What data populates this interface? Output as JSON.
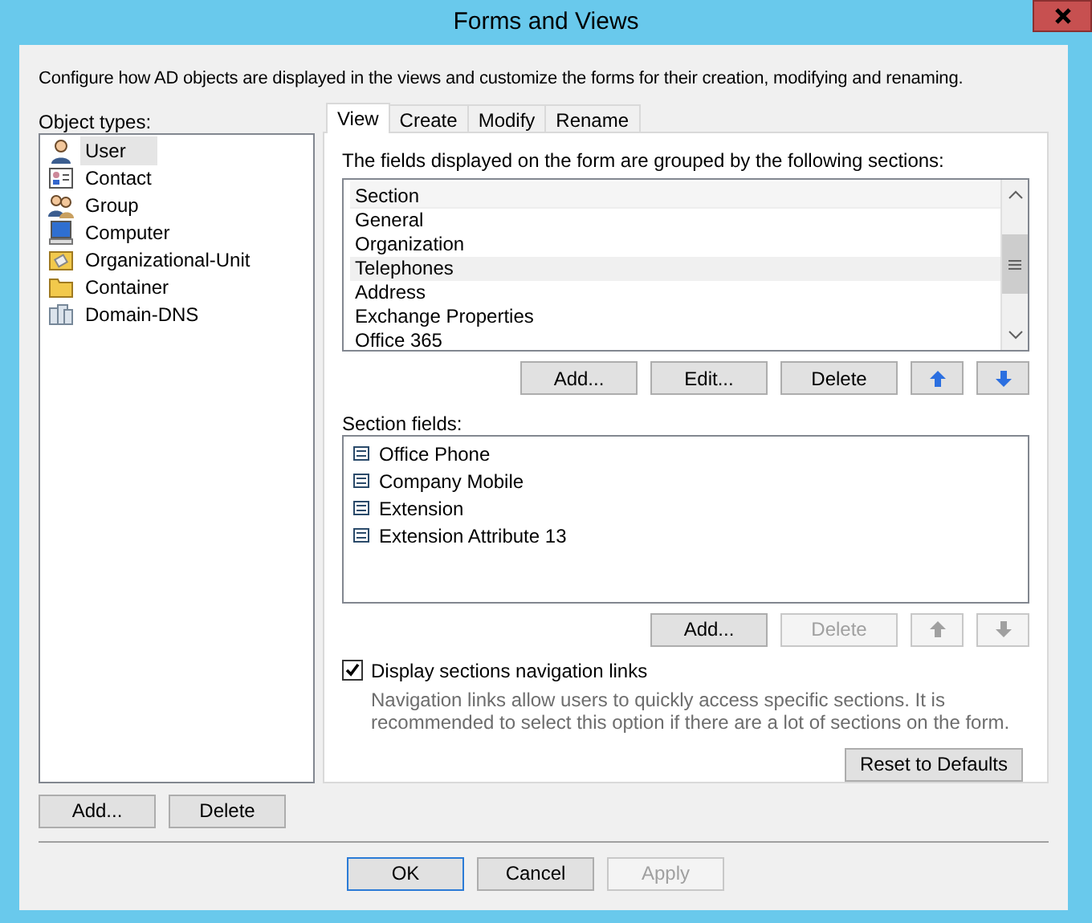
{
  "window": {
    "title": "Forms and Views"
  },
  "description": "Configure how AD objects are displayed in the views and customize the forms for their creation, modifying and renaming.",
  "object_types": {
    "label": "Object types:",
    "items": [
      {
        "label": "User",
        "kind": "user",
        "selected": true
      },
      {
        "label": "Contact",
        "kind": "contact",
        "selected": false
      },
      {
        "label": "Group",
        "kind": "group",
        "selected": false
      },
      {
        "label": "Computer",
        "kind": "computer",
        "selected": false
      },
      {
        "label": "Organizational-Unit",
        "kind": "ou",
        "selected": false
      },
      {
        "label": "Container",
        "kind": "container",
        "selected": false
      },
      {
        "label": "Domain-DNS",
        "kind": "domain",
        "selected": false
      }
    ]
  },
  "left_buttons": [
    "Add...",
    "Delete"
  ],
  "tabs": [
    {
      "label": "View",
      "selected": true
    },
    {
      "label": "Create",
      "selected": false
    },
    {
      "label": "Modify",
      "selected": false
    },
    {
      "label": "Rename",
      "selected": false
    }
  ],
  "sections": {
    "caption": "The fields displayed on the form are grouped by the following sections:",
    "header": "Section",
    "items": [
      {
        "label": "General",
        "selected": false
      },
      {
        "label": "Organization",
        "selected": false
      },
      {
        "label": "Telephones",
        "selected": true
      },
      {
        "label": "Address",
        "selected": false
      },
      {
        "label": "Exchange Properties",
        "selected": false
      },
      {
        "label": "Office 365",
        "selected": false
      }
    ],
    "buttons": [
      {
        "kind": "text",
        "label": "Add...",
        "disabled": false
      },
      {
        "kind": "text",
        "label": "Edit...",
        "disabled": false
      },
      {
        "kind": "text",
        "label": "Delete",
        "disabled": false
      },
      {
        "kind": "up",
        "disabled": false
      },
      {
        "kind": "down",
        "disabled": false
      }
    ]
  },
  "section_fields": {
    "label": "Section fields:",
    "items": [
      "Office Phone",
      "Company Mobile",
      "Extension",
      "Extension Attribute 13"
    ],
    "buttons": [
      {
        "kind": "text",
        "label": "Add...",
        "disabled": false
      },
      {
        "kind": "text",
        "label": "Delete",
        "disabled": true
      },
      {
        "kind": "up",
        "disabled": true
      },
      {
        "kind": "down",
        "disabled": true
      }
    ]
  },
  "navigation_links": {
    "label": "Display sections navigation links",
    "checked": true,
    "hint": "Navigation links allow users to quickly access specific sections. It is recommended to select this option if there are a lot of sections on the form."
  },
  "reset_button": "Reset to Defaults",
  "dialog_buttons": [
    {
      "label": "OK",
      "default": true,
      "disabled": false
    },
    {
      "label": "Cancel",
      "default": false,
      "disabled": false
    },
    {
      "label": "Apply",
      "default": false,
      "disabled": true
    }
  ]
}
